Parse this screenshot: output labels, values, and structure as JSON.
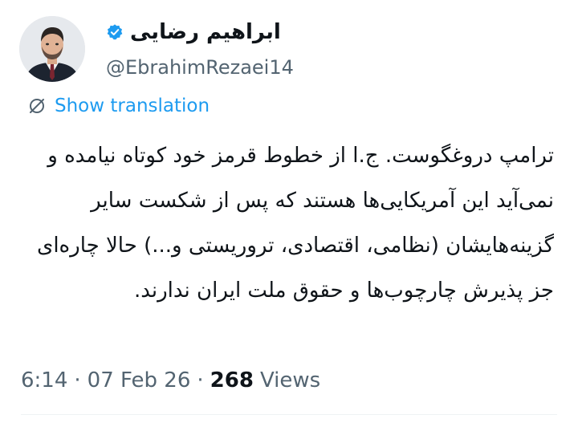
{
  "author": {
    "display_name": "ابراهیم رضایی",
    "handle": "@EbrahimRezaei14",
    "verified": true,
    "avatar_icon": "profile-photo"
  },
  "translate": {
    "label": "Show translation",
    "icon": "translate-icon"
  },
  "tweet": {
    "text": "ترامپ دروغگوست. ج.ا از خطوط قرمز خود کوتاه نیامده و نمی‌آید این آمریکایی‌ها هستند که پس از شکست سایر گزینه‌هایشان (نظامی، اقتصادی، تروریستی و...) حالا چاره‌ای جز پذیرش چارچوب‌ها و حقوق ملت ایران ندارند."
  },
  "meta": {
    "time": "6:14",
    "separator": "·",
    "date": "07 Feb 26",
    "views_count": "268",
    "views_label": "Views"
  },
  "colors": {
    "link": "#1d9bf0",
    "muted": "#536471",
    "text": "#0f1419",
    "verified_badge": "#1d9bf0"
  }
}
